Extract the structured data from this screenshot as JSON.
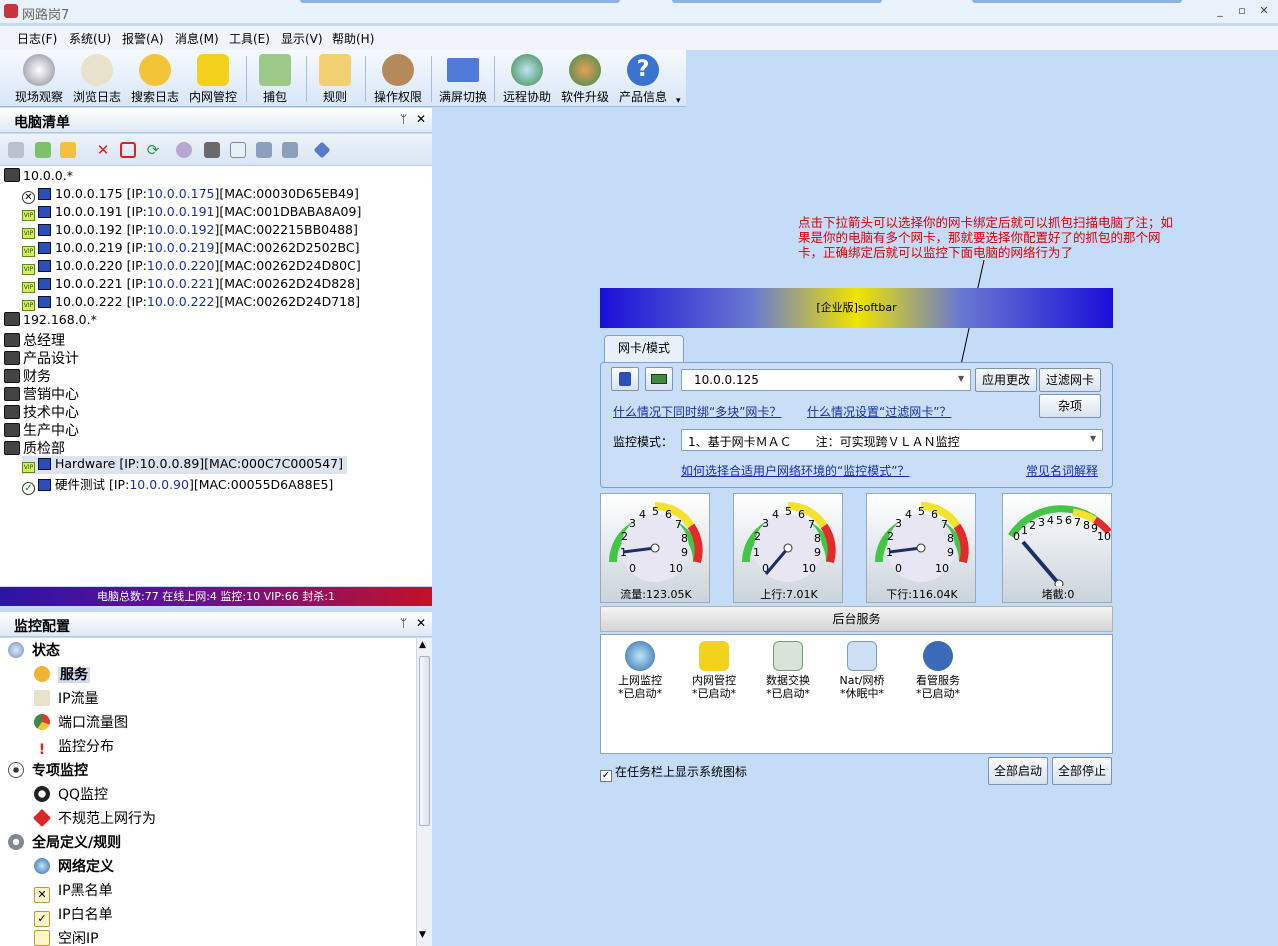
{
  "window": {
    "title": "网路岗7"
  },
  "menu": [
    "日志(F)",
    "系统(U)",
    "报警(A)",
    "消息(M)",
    "工具(E)",
    "显示(V)",
    "帮助(H)"
  ],
  "toolbar": [
    {
      "label": "现场观察",
      "icon": "eye-icon"
    },
    {
      "label": "浏览日志",
      "icon": "browse-log-icon"
    },
    {
      "label": "搜索日志",
      "icon": "search-log-icon"
    },
    {
      "label": "内网管控",
      "icon": "lan-control-icon"
    },
    {
      "label": "捕包",
      "icon": "capture-icon"
    },
    {
      "label": "规则",
      "icon": "rules-icon"
    },
    {
      "label": "操作权限",
      "icon": "users-icon"
    },
    {
      "label": "满屏切换",
      "icon": "fullscreen-icon"
    },
    {
      "label": "远程协助",
      "icon": "remote-icon"
    },
    {
      "label": "软件升级",
      "icon": "upgrade-icon"
    },
    {
      "label": "产品信息",
      "icon": "help-icon"
    }
  ],
  "pcpanel": {
    "title": "电脑清单",
    "groups": [
      {
        "name": "10.0.0.*",
        "items": [
          {
            "name": "10.0.0.175",
            "ip": "10.0.0.175",
            "mac": "00030D65EB49",
            "status": "blocked"
          },
          {
            "name": "10.0.0.191",
            "ip": "10.0.0.191",
            "mac": "001DBABA8A09",
            "status": "vip"
          },
          {
            "name": "10.0.0.192",
            "ip": "10.0.0.192",
            "mac": "002215BB0488",
            "status": "vip"
          },
          {
            "name": "10.0.0.219",
            "ip": "10.0.0.219",
            "mac": "00262D2502BC",
            "status": "vip"
          },
          {
            "name": "10.0.0.220",
            "ip": "10.0.0.220",
            "mac": "00262D24D80C",
            "status": "vip"
          },
          {
            "name": "10.0.0.221",
            "ip": "10.0.0.221",
            "mac": "00262D24D828",
            "status": "vip"
          },
          {
            "name": "10.0.0.222",
            "ip": "10.0.0.222",
            "mac": "00262D24D718",
            "status": "vip"
          }
        ]
      },
      {
        "name": "192.168.0.*",
        "items": []
      },
      {
        "name": "总经理",
        "items": []
      },
      {
        "name": "产品设计",
        "items": []
      },
      {
        "name": "财务",
        "items": []
      },
      {
        "name": "营销中心",
        "items": []
      },
      {
        "name": "技术中心",
        "items": []
      },
      {
        "name": "生产中心",
        "items": []
      },
      {
        "name": "质检部",
        "items": [
          {
            "name": "Hardware",
            "ip": "10.0.0.89",
            "mac": "000C7C000547",
            "status": "vip"
          },
          {
            "name": "硬件测试",
            "ip": "10.0.0.90",
            "mac": "00055D6A88E5",
            "status": "ok"
          }
        ]
      }
    ],
    "status": "电脑总数:77   在线上网:4   监控:10   VIP:66   封杀:1"
  },
  "cfgpanel": {
    "title": "监控配置",
    "items": [
      {
        "label": "状态",
        "level": 0,
        "bold": true
      },
      {
        "label": "服务",
        "level": 1,
        "bold": true,
        "selected": true
      },
      {
        "label": "IP流量",
        "level": 1
      },
      {
        "label": "端口流量图",
        "level": 1
      },
      {
        "label": "监控分布",
        "level": 1
      },
      {
        "label": "专项监控",
        "level": 0,
        "bold": true
      },
      {
        "label": "QQ监控",
        "level": 1
      },
      {
        "label": "不规范上网行为",
        "level": 1
      },
      {
        "label": "全局定义/规则",
        "level": 0,
        "bold": true
      },
      {
        "label": "网络定义",
        "level": 1,
        "bold": true
      },
      {
        "label": "IP黑名单",
        "level": 1
      },
      {
        "label": "IP白名单",
        "level": 1
      },
      {
        "label": "空闲IP",
        "level": 1
      }
    ]
  },
  "note": "点击下拉箭头可以选择你的网卡绑定后就可以抓包扫描电脑了注；如果是你的电脑有多个网卡，那就要选择你配置好了的抓包的那个网卡，正确绑定后就可以监控下面电脑的网络行为了",
  "softbar": {
    "banner": "[企业版]softbar"
  },
  "nic": {
    "tab": "网卡/模式",
    "selected": "10.0.0.125",
    "apply": "应用更改",
    "filter": "过滤网卡",
    "misc": "杂项",
    "link1": "什么情况下同时绑“多块”网卡？",
    "link2": "什么情况设置“过滤网卡”？",
    "mode_label": "监控模式：",
    "mode_value": "1、基于网卡ＭＡＣ　　注：可实现跨ＶＬＡＮ监控",
    "link3": "如何选择合适用户网络环境的“监控模式”？",
    "link4": "常见名词解释"
  },
  "gauges": [
    {
      "label": "流量:123.05K",
      "value": 1.2
    },
    {
      "label": "上行:7.01K",
      "value": 0.4
    },
    {
      "label": "下行:116.04K",
      "value": 1.3
    },
    {
      "label": "堵截:0",
      "value": 0
    }
  ],
  "services": {
    "title": "后台服务",
    "items": [
      {
        "name": "上网监控",
        "state": "*已启动*",
        "icon": "globe-icon"
      },
      {
        "name": "内网管控",
        "state": "*已启动*",
        "icon": "lan-icon"
      },
      {
        "name": "数据交换",
        "state": "*已启动*",
        "icon": "exchange-icon"
      },
      {
        "name": "Nat/网桥",
        "state": "*休眠中*",
        "icon": "nat-icon"
      },
      {
        "name": "看管服务",
        "state": "*已启动*",
        "icon": "guard-icon"
      }
    ]
  },
  "footer": {
    "tray": "在任务栏上显示系统图标",
    "start_all": "全部启动",
    "stop_all": "全部停止"
  }
}
